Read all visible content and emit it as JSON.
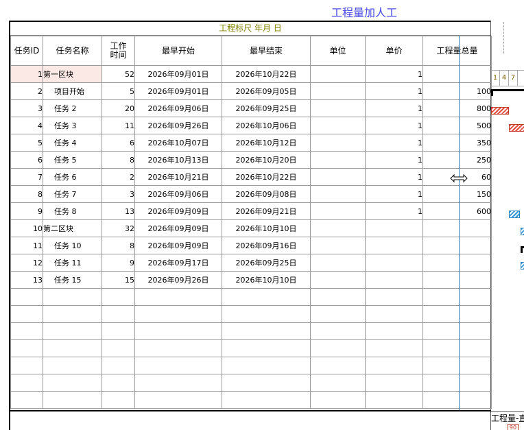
{
  "page_title": "工程量加人工",
  "ruler_title": "工程标尺 年月 日",
  "columns": [
    "任务ID",
    "任务名称",
    "工作时间",
    "最早开始",
    "最早结束",
    "单位",
    "单价",
    "工程量总量"
  ],
  "rows": [
    {
      "id": "1",
      "name": "第一区块",
      "work": "52",
      "start": "2026年09月01日",
      "end": "2026年10月22日",
      "unit": "",
      "price": "1",
      "qty": "",
      "level": 0
    },
    {
      "id": "2",
      "name": "项目开始",
      "work": "5",
      "start": "2026年09月01日",
      "end": "2026年09月05日",
      "unit": "",
      "price": "1",
      "qty": "100",
      "level": 1
    },
    {
      "id": "3",
      "name": "任务 2",
      "work": "20",
      "start": "2026年09月06日",
      "end": "2026年09月25日",
      "unit": "",
      "price": "1",
      "qty": "800",
      "level": 1
    },
    {
      "id": "4",
      "name": "任务 3",
      "work": "11",
      "start": "2026年09月26日",
      "end": "2026年10月06日",
      "unit": "",
      "price": "1",
      "qty": "500",
      "level": 1
    },
    {
      "id": "5",
      "name": "任务 4",
      "work": "6",
      "start": "2026年10月07日",
      "end": "2026年10月12日",
      "unit": "",
      "price": "1",
      "qty": "350",
      "level": 1
    },
    {
      "id": "6",
      "name": "任务 5",
      "work": "8",
      "start": "2026年10月13日",
      "end": "2026年10月20日",
      "unit": "",
      "price": "1",
      "qty": "250",
      "level": 1
    },
    {
      "id": "7",
      "name": "任务 6",
      "work": "2",
      "start": "2026年10月21日",
      "end": "2026年10月22日",
      "unit": "",
      "price": "1",
      "qty": "60",
      "level": 1
    },
    {
      "id": "8",
      "name": "任务 7",
      "work": "3",
      "start": "2026年09月06日",
      "end": "2026年09月08日",
      "unit": "",
      "price": "1",
      "qty": "150",
      "level": 1
    },
    {
      "id": "9",
      "name": "任务 8",
      "work": "13",
      "start": "2026年09月09日",
      "end": "2026年09月21日",
      "unit": "",
      "price": "1",
      "qty": "600",
      "level": 1
    },
    {
      "id": "10",
      "name": "第二区块",
      "work": "32",
      "start": "2026年09月09日",
      "end": "2026年10月10日",
      "unit": "",
      "price": "",
      "qty": "",
      "level": 0
    },
    {
      "id": "11",
      "name": "任务 10",
      "work": "8",
      "start": "2026年09月09日",
      "end": "2026年09月16日",
      "unit": "",
      "price": "",
      "qty": "",
      "level": 1
    },
    {
      "id": "12",
      "name": "任务 11",
      "work": "9",
      "start": "2026年09月17日",
      "end": "2026年09月25日",
      "unit": "",
      "price": "",
      "qty": "",
      "level": 1
    },
    {
      "id": "13",
      "name": "任务 15",
      "work": "15",
      "start": "2026年09月26日",
      "end": "2026年10月10日",
      "unit": "",
      "price": "",
      "qty": "",
      "level": 1
    }
  ],
  "empty_rows": 7,
  "gantt": {
    "scale": [
      "1",
      "4",
      "7"
    ],
    "footer_label": "工程量-直",
    "footer_box": "90"
  },
  "colors": {
    "title": "#4a4ae8",
    "ruler": "#808000",
    "divider": "#2e86c1",
    "bar_red": "#e74c3c",
    "bar_blue": "#3498db",
    "row_highlight": "#fbe9e5"
  }
}
